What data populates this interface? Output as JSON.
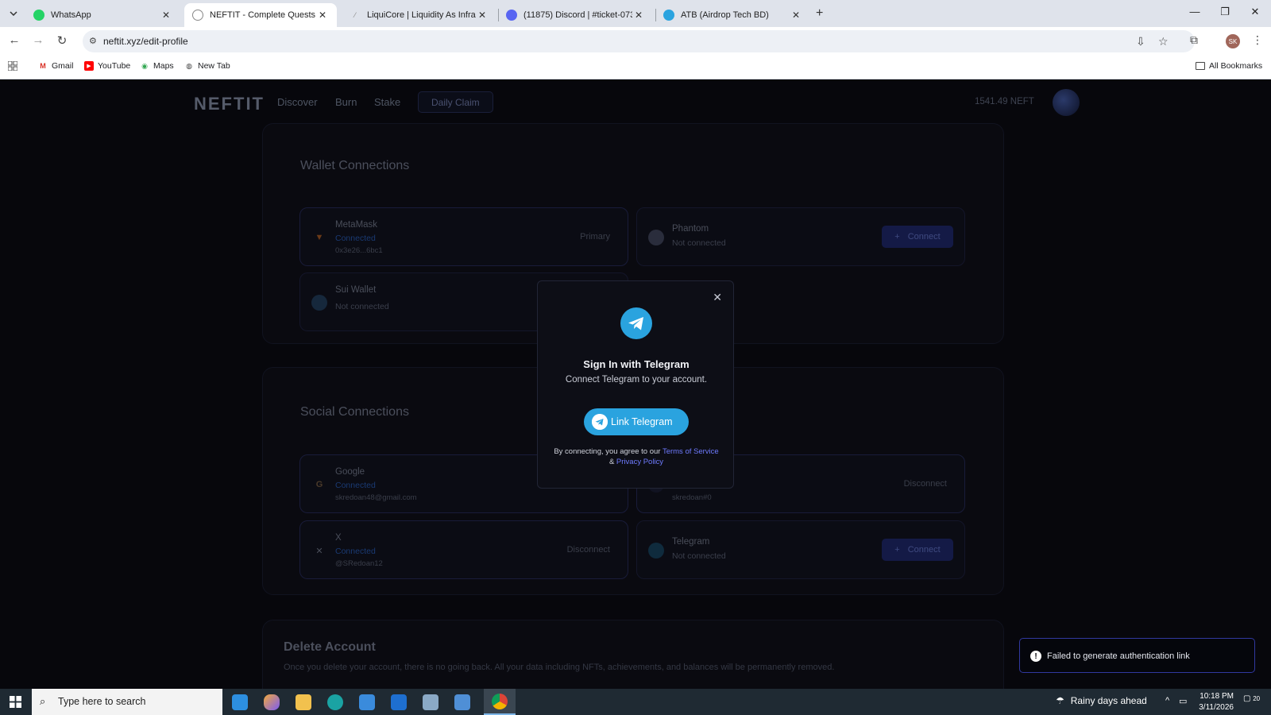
{
  "browser": {
    "tabs": [
      {
        "title": "WhatsApp",
        "active": false
      },
      {
        "title": "NEFTIT - Complete Quests, Earn",
        "active": true
      },
      {
        "title": "LiquiCore | Liquidity As Infrastru",
        "active": false
      },
      {
        "title": "(11875) Discord | #ticket-0735 | I",
        "active": false
      },
      {
        "title": "ATB (Airdrop Tech BD)",
        "active": false
      }
    ],
    "url": "neftit.xyz/edit-profile",
    "profile_initials": "SK",
    "bookmarks": [
      "Gmail",
      "YouTube",
      "Maps",
      "New Tab"
    ],
    "all_bookmarks": "All Bookmarks"
  },
  "site": {
    "logo": "NEFTIT",
    "nav": [
      "Discover",
      "Burn",
      "Stake"
    ],
    "daily_claim": "Daily Claim",
    "balance": "1541.49 NEFT",
    "wallet_section": {
      "title": "Wallet Connections",
      "cards": [
        {
          "name": "MetaMask",
          "status": "Connected",
          "address": "0x3e26...6bc1",
          "action": "Primary"
        },
        {
          "name": "Phantom",
          "status": "Not connected",
          "action": "Connect"
        },
        {
          "name": "Sui Wallet",
          "status": "Not connected"
        }
      ]
    },
    "social_section": {
      "title": "Social Connections",
      "cards": [
        {
          "name": "Google",
          "status": "Connected",
          "address": "skredoan48@gmail.com"
        },
        {
          "name": "",
          "status": "",
          "address": "skredoan#0",
          "action": "Disconnect"
        },
        {
          "name": "X",
          "status": "Connected",
          "address": "@SRedoan12",
          "action": "Disconnect"
        },
        {
          "name": "Telegram",
          "status": "Not connected",
          "action": "Connect"
        }
      ]
    },
    "delete_section": {
      "title": "Delete Account",
      "description": "Once you delete your account, there is no going back. All your data including NFTs, achievements, and balances will be permanently removed."
    }
  },
  "modal": {
    "title": "Sign In with Telegram",
    "subtitle": "Connect Telegram to your account.",
    "button": "Link Telegram",
    "terms_prefix": "By connecting, you agree to our",
    "terms_link": "Terms of Service",
    "terms_and": "&",
    "privacy_link": "Privacy Policy"
  },
  "toast": {
    "message": "Failed to generate authentication link"
  },
  "taskbar": {
    "search_placeholder": "Type here to search",
    "weather": "Rainy days ahead",
    "time": "10:18 PM",
    "date": "3/11/2026",
    "notification_count": "20"
  },
  "colors": {
    "telegram_blue": "#2aa3df",
    "accent_indigo": "#3138a0",
    "link": "#6f7bff"
  }
}
